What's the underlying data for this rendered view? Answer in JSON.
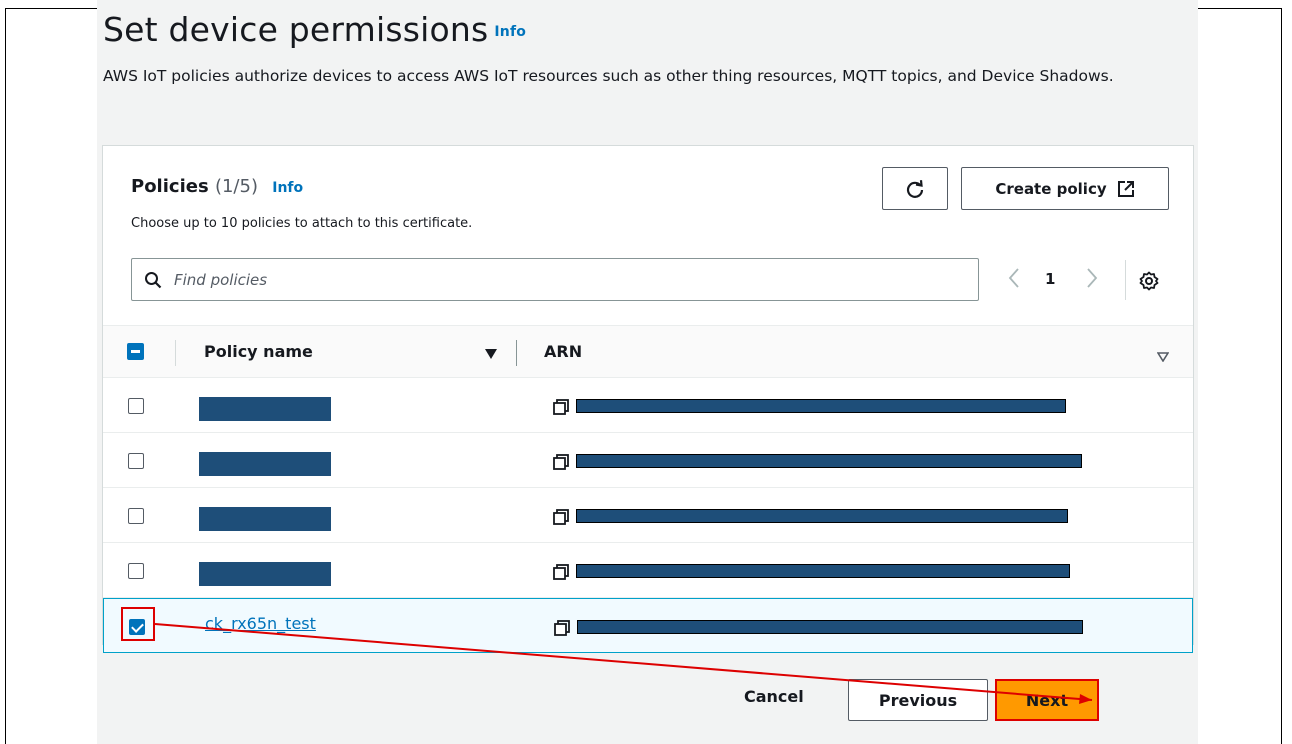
{
  "page": {
    "title": "Set device permissions",
    "title_info": "Info",
    "description": "AWS IoT policies authorize devices to access AWS IoT resources such as other thing resources, MQTT topics, and Device Shadows."
  },
  "policies": {
    "title": "Policies",
    "count": "(1/5)",
    "info": "Info",
    "subtitle": "Choose up to 10 policies to attach to this certificate.",
    "create_label": "Create policy",
    "search_placeholder": "Find policies",
    "page_number": "1",
    "columns": {
      "name": "Policy name",
      "arn": "ARN"
    },
    "rows": [
      {
        "name": "",
        "checked": false
      },
      {
        "name": "",
        "checked": false
      },
      {
        "name": "",
        "checked": false
      },
      {
        "name": "",
        "checked": false
      },
      {
        "name": "ck_rx65n_test",
        "checked": true
      }
    ]
  },
  "footer": {
    "cancel": "Cancel",
    "previous": "Previous",
    "next": "Next"
  },
  "colors": {
    "accent": "#0073bb",
    "primary_button": "#ff9900",
    "annotation": "#dd0000",
    "redaction": "#1e4e79"
  },
  "icons": [
    "refresh-icon",
    "external-link-icon",
    "search-icon",
    "chevron-left-icon",
    "chevron-right-icon",
    "settings-icon",
    "sort-down-icon",
    "copy-icon"
  ]
}
